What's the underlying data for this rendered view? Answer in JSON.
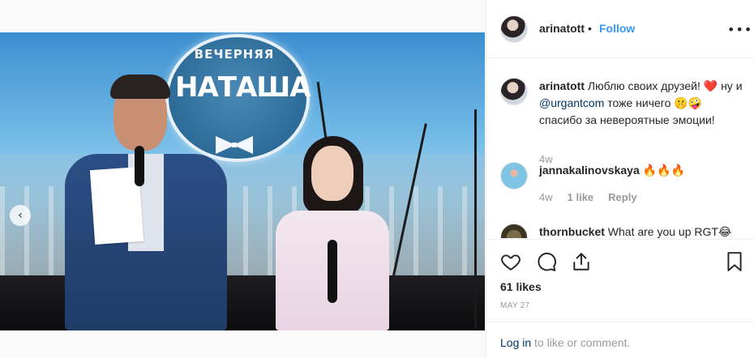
{
  "media": {
    "screen_logo_top": "ВЕЧЕРНЯЯ",
    "screen_logo_main": "НАТАША",
    "prev_arrow_icon": "chevron-left-icon",
    "carousel": {
      "total": 2,
      "active_index": 1
    }
  },
  "header": {
    "username": "arinatott",
    "separator": "•",
    "follow_label": "Follow",
    "more_icon": "more-horizontal-icon"
  },
  "comments": [
    {
      "username": "arinatott",
      "text_before": " Люблю своих друзей! ❤️ ну и ",
      "mention": "@urgantcom",
      "text_after": " тоже ничего 🤫🤪 спасибо за невероятные эмоции!",
      "time": "4w"
    },
    {
      "username": "jannakalinovskaya",
      "text": " 🔥🔥🔥",
      "time": "4w",
      "likes": "1 like",
      "reply_label": "Reply"
    },
    {
      "username": "thornbucket",
      "text": " What are you up RGT😂"
    }
  ],
  "actions": {
    "like_icon": "heart-icon",
    "comment_icon": "comment-icon",
    "share_icon": "share-icon",
    "save_icon": "bookmark-icon"
  },
  "likes_label": "61 likes",
  "date_label": "MAY 27",
  "login": {
    "link_label": "Log in",
    "suffix": " to like or comment."
  },
  "colors": {
    "link_blue": "#3897f0",
    "mention_navy": "#003569",
    "meta_grey": "#999999",
    "text": "#262626"
  }
}
